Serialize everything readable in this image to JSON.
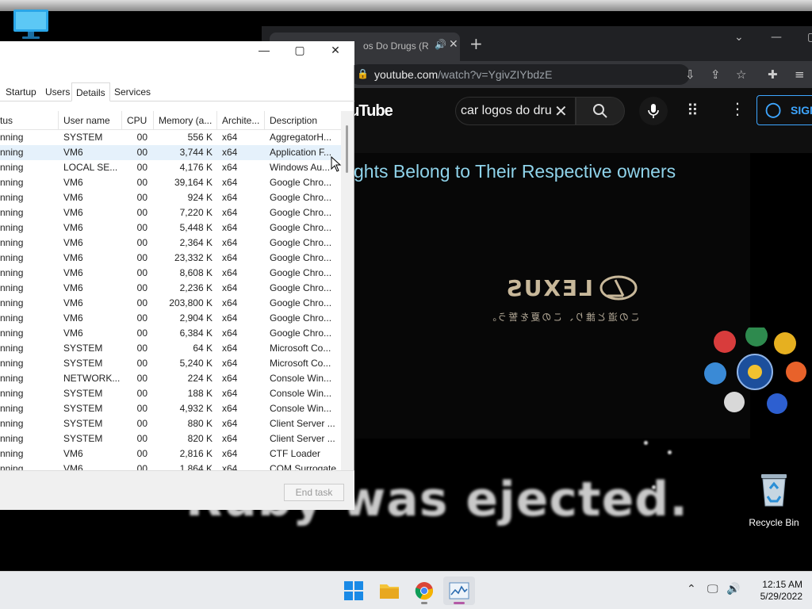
{
  "desktop": {
    "overlay_text": "Ruby was ejected.",
    "recycle_bin_label": "Recycle Bin"
  },
  "browser": {
    "tab_title": "os Do Drugs (R",
    "new_tab_label": "+",
    "url_host": "youtube.com",
    "url_path": "/watch?v=YgivZIYbdzE",
    "youtube": {
      "logo_text": "ouTube",
      "search_value": "car logos do dru",
      "sign_in_label": "SIGN",
      "video_caption": "ghts Belong to Their Respective owners",
      "video_subtitle": "この道と誰り、この夏を誓う。",
      "video_logo_color": "#c8b89a"
    }
  },
  "task_manager": {
    "tabs": [
      "Startup",
      "Users",
      "Details",
      "Services"
    ],
    "active_tab": "Details",
    "columns": [
      "tus",
      "User name",
      "CPU",
      "Memory (a...",
      "Archite...",
      "Description"
    ],
    "rows": [
      {
        "status": "nning",
        "user": "SYSTEM",
        "cpu": "00",
        "memory": "556 K",
        "arch": "x64",
        "desc": "AggregatorH..."
      },
      {
        "status": "nning",
        "user": "VM6",
        "cpu": "00",
        "memory": "3,744 K",
        "arch": "x64",
        "desc": "Application F..."
      },
      {
        "status": "nning",
        "user": "LOCAL SE...",
        "cpu": "00",
        "memory": "4,176 K",
        "arch": "x64",
        "desc": "Windows Au..."
      },
      {
        "status": "nning",
        "user": "VM6",
        "cpu": "00",
        "memory": "39,164 K",
        "arch": "x64",
        "desc": "Google Chro..."
      },
      {
        "status": "nning",
        "user": "VM6",
        "cpu": "00",
        "memory": "924 K",
        "arch": "x64",
        "desc": "Google Chro..."
      },
      {
        "status": "nning",
        "user": "VM6",
        "cpu": "00",
        "memory": "7,220 K",
        "arch": "x64",
        "desc": "Google Chro..."
      },
      {
        "status": "nning",
        "user": "VM6",
        "cpu": "00",
        "memory": "5,448 K",
        "arch": "x64",
        "desc": "Google Chro..."
      },
      {
        "status": "nning",
        "user": "VM6",
        "cpu": "00",
        "memory": "2,364 K",
        "arch": "x64",
        "desc": "Google Chro..."
      },
      {
        "status": "nning",
        "user": "VM6",
        "cpu": "00",
        "memory": "23,332 K",
        "arch": "x64",
        "desc": "Google Chro..."
      },
      {
        "status": "nning",
        "user": "VM6",
        "cpu": "00",
        "memory": "8,608 K",
        "arch": "x64",
        "desc": "Google Chro..."
      },
      {
        "status": "nning",
        "user": "VM6",
        "cpu": "00",
        "memory": "2,236 K",
        "arch": "x64",
        "desc": "Google Chro..."
      },
      {
        "status": "nning",
        "user": "VM6",
        "cpu": "00",
        "memory": "203,800 K",
        "arch": "x64",
        "desc": "Google Chro..."
      },
      {
        "status": "nning",
        "user": "VM6",
        "cpu": "00",
        "memory": "2,904 K",
        "arch": "x64",
        "desc": "Google Chro..."
      },
      {
        "status": "nning",
        "user": "VM6",
        "cpu": "00",
        "memory": "6,384 K",
        "arch": "x64",
        "desc": "Google Chro..."
      },
      {
        "status": "nning",
        "user": "SYSTEM",
        "cpu": "00",
        "memory": "64 K",
        "arch": "x64",
        "desc": "Microsoft Co..."
      },
      {
        "status": "nning",
        "user": "SYSTEM",
        "cpu": "00",
        "memory": "5,240 K",
        "arch": "x64",
        "desc": "Microsoft Co..."
      },
      {
        "status": "nning",
        "user": "NETWORK...",
        "cpu": "00",
        "memory": "224 K",
        "arch": "x64",
        "desc": "Console Win..."
      },
      {
        "status": "nning",
        "user": "SYSTEM",
        "cpu": "00",
        "memory": "188 K",
        "arch": "x64",
        "desc": "Console Win..."
      },
      {
        "status": "nning",
        "user": "SYSTEM",
        "cpu": "00",
        "memory": "4,932 K",
        "arch": "x64",
        "desc": "Console Win..."
      },
      {
        "status": "nning",
        "user": "SYSTEM",
        "cpu": "00",
        "memory": "880 K",
        "arch": "x64",
        "desc": "Client Server ..."
      },
      {
        "status": "nning",
        "user": "SYSTEM",
        "cpu": "00",
        "memory": "820 K",
        "arch": "x64",
        "desc": "Client Server ..."
      },
      {
        "status": "nning",
        "user": "VM6",
        "cpu": "00",
        "memory": "2,816 K",
        "arch": "x64",
        "desc": "CTF Loader"
      },
      {
        "status": "nning",
        "user": "VM6",
        "cpu": "00",
        "memory": "1,864 K",
        "arch": "x64",
        "desc": "COM Surrogate"
      }
    ],
    "selected_row": 1,
    "end_task_label": "End task"
  },
  "taskbar": {
    "time": "12:15 AM",
    "date": "5/29/2022",
    "accent_active": "#b45aa6"
  }
}
